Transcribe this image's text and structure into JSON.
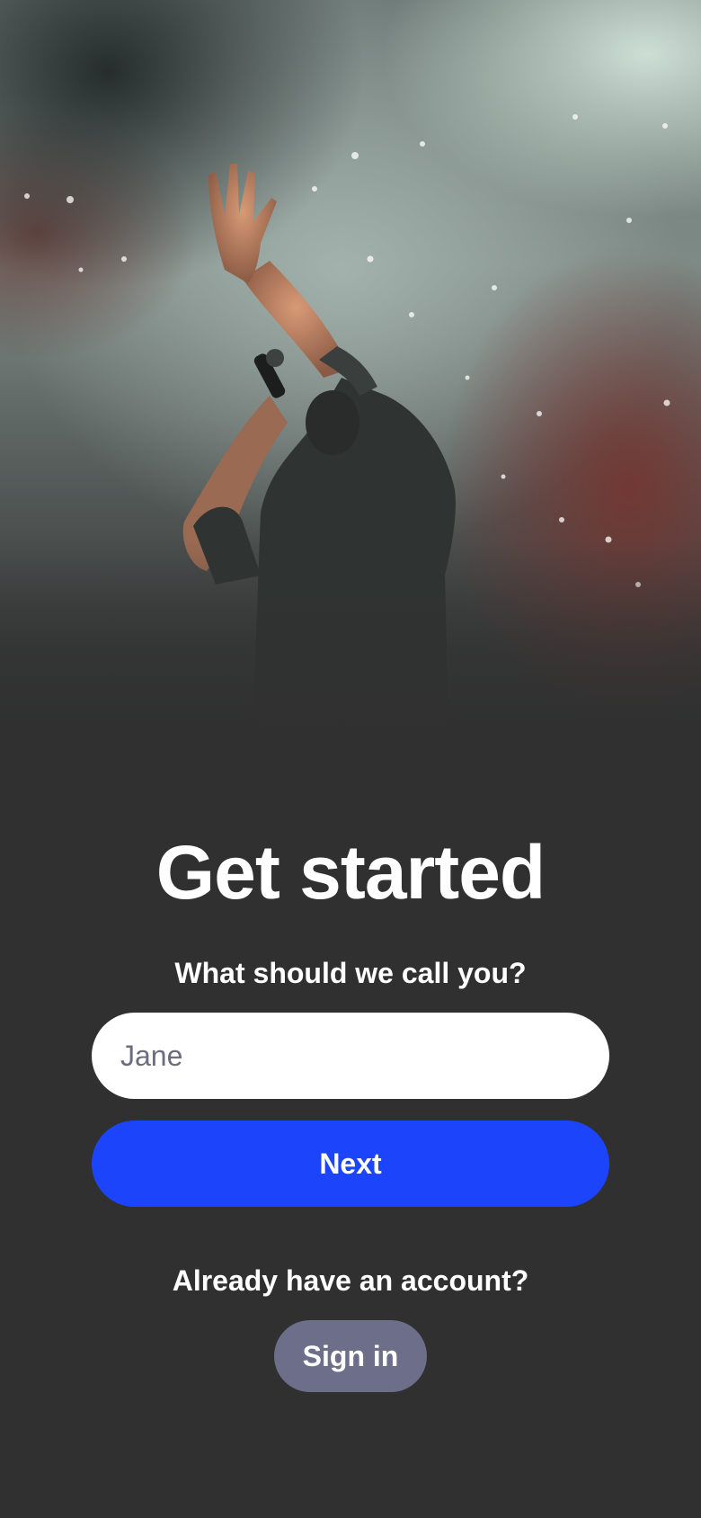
{
  "hero": {
    "image_description_icon": "concert-performer-photo"
  },
  "title": "Get started",
  "prompt": "What should we call you?",
  "name_input": {
    "placeholder": "Jane",
    "value": ""
  },
  "next_button": {
    "label": "Next"
  },
  "signin": {
    "question": "Already have an account?",
    "button_label": "Sign in"
  },
  "colors": {
    "background": "#303030",
    "primary": "#1c45fb",
    "secondary": "#6c6e8a",
    "text": "#ffffff",
    "placeholder": "#6c6c7e"
  }
}
